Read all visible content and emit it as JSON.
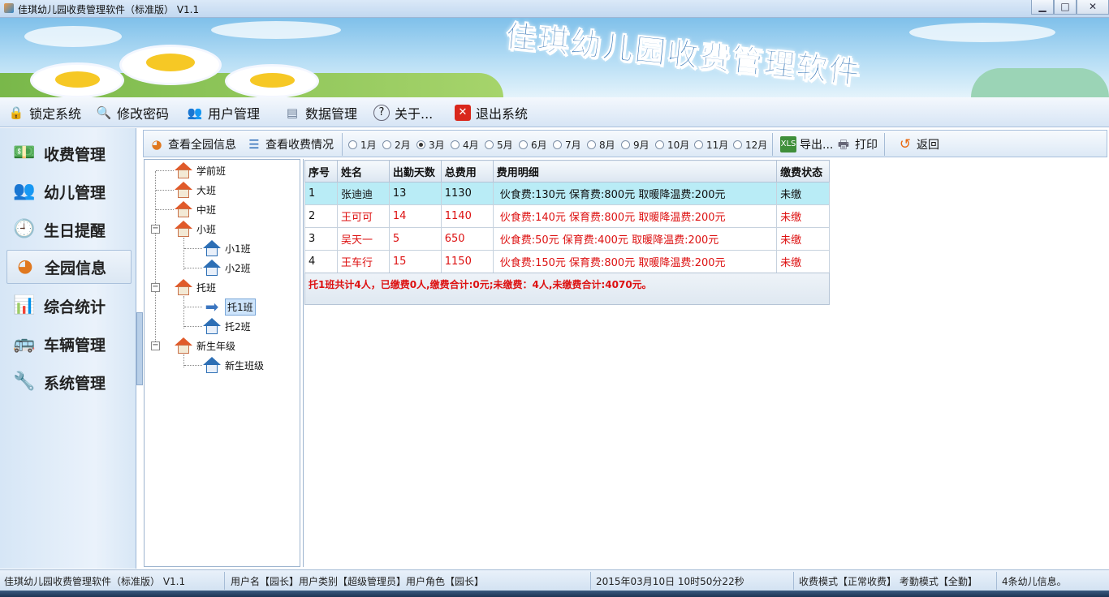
{
  "window": {
    "title": "佳琪幼儿园收费管理软件（标准版） V1.1",
    "buttons": {
      "minimize": "▁",
      "maximize": "□",
      "close": "✕"
    }
  },
  "banner": {
    "text": "佳琪幼儿园收费管理软件"
  },
  "menu": [
    {
      "label": "锁定系统",
      "icon": "lock-icon"
    },
    {
      "label": "修改密码",
      "icon": "magnifier-key-icon"
    },
    {
      "label": "用户管理",
      "icon": "users-icon"
    },
    {
      "label": "数据管理",
      "icon": "database-icon"
    },
    {
      "label": "关于...",
      "icon": "help-icon"
    },
    {
      "label": "退出系统",
      "icon": "exit-icon"
    }
  ],
  "nav": [
    {
      "label": "收费管理",
      "icon": "money-icon"
    },
    {
      "label": "幼儿管理",
      "icon": "children-icon"
    },
    {
      "label": "生日提醒",
      "icon": "clock-icon"
    },
    {
      "label": "全园信息",
      "icon": "pie-chart-icon",
      "active": true
    },
    {
      "label": "综合统计",
      "icon": "statistics-icon"
    },
    {
      "label": "车辆管理",
      "icon": "bus-icon"
    },
    {
      "label": "系统管理",
      "icon": "tools-icon"
    }
  ],
  "toolbar": {
    "view_all": "查看全园信息",
    "view_fees": "查看收费情况",
    "months": [
      "1月",
      "2月",
      "3月",
      "4月",
      "5月",
      "6月",
      "7月",
      "8月",
      "9月",
      "10月",
      "11月",
      "12月"
    ],
    "selected_month": "3月",
    "export": "导出...",
    "print": "打印",
    "back": "返回"
  },
  "tree": {
    "nodes": [
      {
        "label": "学前班",
        "level": 0,
        "expander": ""
      },
      {
        "label": "大班",
        "level": 0,
        "expander": ""
      },
      {
        "label": "中班",
        "level": 0,
        "expander": ""
      },
      {
        "label": "小班",
        "level": 0,
        "expander": "−"
      },
      {
        "label": "小1班",
        "level": 1
      },
      {
        "label": "小2班",
        "level": 1
      },
      {
        "label": "托班",
        "level": 0,
        "expander": "−"
      },
      {
        "label": "托1班",
        "level": 1,
        "selected": true
      },
      {
        "label": "托2班",
        "level": 1
      },
      {
        "label": "新生年级",
        "level": 0,
        "expander": "−"
      },
      {
        "label": "新生班级",
        "level": 1
      }
    ]
  },
  "grid": {
    "columns": [
      "序号",
      "姓名",
      "出勤天数",
      "总费用",
      "费用明细",
      "缴费状态"
    ],
    "rows": [
      {
        "no": "1",
        "name": "张迪迪",
        "days": "13",
        "total": "1130",
        "detail": "伙食费:130元 保育费:800元 取暖降温费:200元",
        "status": "未缴"
      },
      {
        "no": "2",
        "name": "王可可",
        "days": "14",
        "total": "1140",
        "detail": "伙食费:140元 保育费:800元 取暖降温费:200元",
        "status": "未缴"
      },
      {
        "no": "3",
        "name": "吴天一",
        "days": "5",
        "total": "650",
        "detail": "伙食费:50元 保育费:400元 取暖降温费:200元",
        "status": "未缴"
      },
      {
        "no": "4",
        "name": "王车行",
        "days": "15",
        "total": "1150",
        "detail": "伙食费:150元 保育费:800元 取暖降温费:200元",
        "status": "未缴"
      }
    ],
    "summary": "托1班共计4人，已缴费0人,缴费合计:0元;未缴费：4人,未缴费合计:4070元。"
  },
  "status": {
    "app": "佳琪幼儿园收费管理软件（标准版） V1.1",
    "user": "用户名【园长】用户类别【超级管理员】用户角色【园长】",
    "time": "2015年03月10日 10时50分22秒",
    "mode": "收费模式【正常收费】  考勤模式【全勤】",
    "count": "4条幼儿信息。"
  },
  "colors": {
    "accent": "#2b6fb3",
    "unpaid": "#dd1111",
    "highlight_row": "#b9ecf6"
  }
}
